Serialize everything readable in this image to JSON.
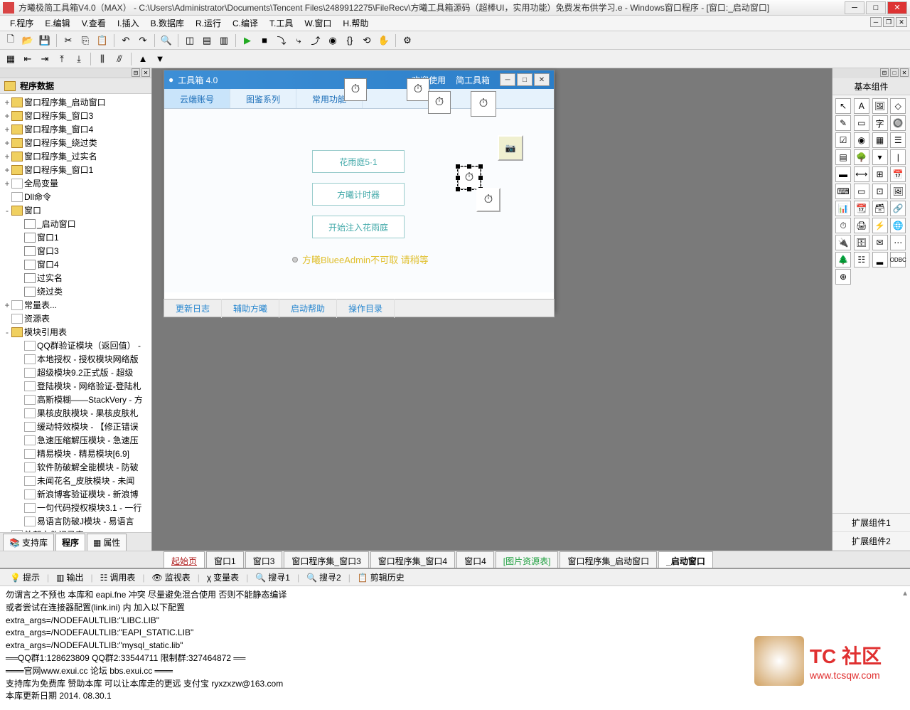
{
  "title": "方曦极简工具箱V4.0（MAX）  - C:\\Users\\Administrator\\Documents\\Tencent Files\\2489912275\\FileRecv\\方曦工具箱源码（超棒UI，实用功能）免费发布供学习.e - Windows窗口程序 - [窗口:_启动窗口]",
  "menus": [
    "F.程序",
    "E.编辑",
    "V.查看",
    "I.插入",
    "B.数据库",
    "R.运行",
    "C.编译",
    "T.工具",
    "W.窗口",
    "H.帮助"
  ],
  "left": {
    "title": "程序数据",
    "tree": [
      {
        "ind": 0,
        "toggle": "+",
        "icon": "folder",
        "label": "窗口程序集_启动窗口"
      },
      {
        "ind": 0,
        "toggle": "+",
        "icon": "folder",
        "label": "窗口程序集_窗口3"
      },
      {
        "ind": 0,
        "toggle": "+",
        "icon": "folder",
        "label": "窗口程序集_窗口4"
      },
      {
        "ind": 0,
        "toggle": "+",
        "icon": "folder",
        "label": "窗口程序集_绕过类"
      },
      {
        "ind": 0,
        "toggle": "+",
        "icon": "folder",
        "label": "窗口程序集_过实名"
      },
      {
        "ind": 0,
        "toggle": "+",
        "icon": "folder",
        "label": "窗口程序集_窗口1"
      },
      {
        "ind": 0,
        "toggle": "+",
        "icon": "file",
        "label": "全局变量"
      },
      {
        "ind": 0,
        "toggle": "",
        "icon": "file",
        "label": "Dll命令"
      },
      {
        "ind": 0,
        "toggle": "-",
        "icon": "folder",
        "label": "窗口"
      },
      {
        "ind": 1,
        "toggle": "",
        "icon": "window",
        "label": "_启动窗口"
      },
      {
        "ind": 1,
        "toggle": "",
        "icon": "window",
        "label": "窗口1"
      },
      {
        "ind": 1,
        "toggle": "",
        "icon": "window",
        "label": "窗口3"
      },
      {
        "ind": 1,
        "toggle": "",
        "icon": "window",
        "label": "窗口4"
      },
      {
        "ind": 1,
        "toggle": "",
        "icon": "window",
        "label": "过实名"
      },
      {
        "ind": 1,
        "toggle": "",
        "icon": "window",
        "label": "绕过类"
      },
      {
        "ind": 0,
        "toggle": "+",
        "icon": "file",
        "label": "常量表..."
      },
      {
        "ind": 0,
        "toggle": "",
        "icon": "file",
        "label": "资源表"
      },
      {
        "ind": 0,
        "toggle": "-",
        "icon": "folder",
        "label": "模块引用表"
      },
      {
        "ind": 1,
        "toggle": "",
        "icon": "module",
        "label": "QQ群验证模块（返回值） -"
      },
      {
        "ind": 1,
        "toggle": "",
        "icon": "module",
        "label": "本地授权 - 授权模块网络版"
      },
      {
        "ind": 1,
        "toggle": "",
        "icon": "module",
        "label": "超级模块9.2正式版 - 超级"
      },
      {
        "ind": 1,
        "toggle": "",
        "icon": "module",
        "label": "登陆模块 - 网络验证-登陆札"
      },
      {
        "ind": 1,
        "toggle": "",
        "icon": "module",
        "label": "高斯模糊——StackVery - 方"
      },
      {
        "ind": 1,
        "toggle": "",
        "icon": "module",
        "label": "果核皮肤模块 - 果核皮肤札"
      },
      {
        "ind": 1,
        "toggle": "",
        "icon": "module",
        "label": "缓动特效模块 - 【修正错误"
      },
      {
        "ind": 1,
        "toggle": "",
        "icon": "module",
        "label": "急速压缩解压模块 - 急速压"
      },
      {
        "ind": 1,
        "toggle": "",
        "icon": "module",
        "label": "精易模块 - 精易模块[6.9]"
      },
      {
        "ind": 1,
        "toggle": "",
        "icon": "module",
        "label": "软件防破解全能模块 - 防破"
      },
      {
        "ind": 1,
        "toggle": "",
        "icon": "module",
        "label": "未闻花名_皮肤模块 - 未闻"
      },
      {
        "ind": 1,
        "toggle": "",
        "icon": "module",
        "label": "新浪博客验证模块 - 新浪博"
      },
      {
        "ind": 1,
        "toggle": "",
        "icon": "module",
        "label": "一句代码授权模块3.1 - 一行"
      },
      {
        "ind": 1,
        "toggle": "",
        "icon": "module",
        "label": "易语言防破J模块 - 易语言"
      },
      {
        "ind": 0,
        "toggle": "",
        "icon": "file",
        "label": "外部文件记录表"
      }
    ],
    "tabs": [
      "支持库",
      "程序",
      "属性"
    ]
  },
  "designer": {
    "aw_title_left": "工具箱 4.0",
    "aw_title_welcome": "欢迎使用",
    "aw_title_sub": "简工具箱",
    "tabs": [
      "云端账号",
      "图鉴系列",
      "常用功能"
    ],
    "btn1": "花雨庭5·1",
    "btn2": "方曦计时器",
    "btn3": "开始注入花雨庭",
    "status": "方曦BlueeAdmin不可取 请稍等",
    "bottom_tabs": [
      "更新日志",
      "辅助方曦",
      "启动帮助",
      "操作目录"
    ]
  },
  "doc_tabs": [
    {
      "label": "起始页",
      "cls": "active"
    },
    {
      "label": "窗口1",
      "cls": ""
    },
    {
      "label": "窗口3",
      "cls": ""
    },
    {
      "label": "窗口程序集_窗口3",
      "cls": ""
    },
    {
      "label": "窗口程序集_窗口4",
      "cls": ""
    },
    {
      "label": "窗口4",
      "cls": ""
    },
    {
      "label": "[图片资源表]",
      "cls": "image"
    },
    {
      "label": "窗口程序集_启动窗口",
      "cls": ""
    },
    {
      "label": "_启动窗口",
      "cls": "current"
    }
  ],
  "output_tabs": [
    "提示",
    "输出",
    "调用表",
    "监视表",
    "变量表",
    "搜寻1",
    "搜寻2",
    "剪辑历史"
  ],
  "output_text": "勿谓言之不预也 本库和 eapi.fne 冲突 尽量避免混合使用 否则不能静态编译\n或者尝试在连接器配置(link.ini) 内 加入以下配置\nextra_args=/NODEFAULTLIB:\"LIBC.LIB\"\nextra_args=/NODEFAULTLIB:\"EAPI_STATIC.LIB\"\nextra_args=/NODEFAULTLIB:\"mysql_static.lib\"\n══QQ群1:128623809 QQ群2:33544711 限制群:327464872 ══\n═══官网www.exui.cc 论坛 bbs.exui.cc ═══\n支持库为免费库 赞助本库 可以让本库走的更远 支付宝 ryxzxzw@163.com\n本库更新日期 2014. 08.30.1",
  "right": {
    "title": "基本组件",
    "footer": [
      "扩展组件1",
      "扩展组件2"
    ]
  },
  "watermark": {
    "big": "TC 社区",
    "url": "www.tcsqw.com"
  }
}
